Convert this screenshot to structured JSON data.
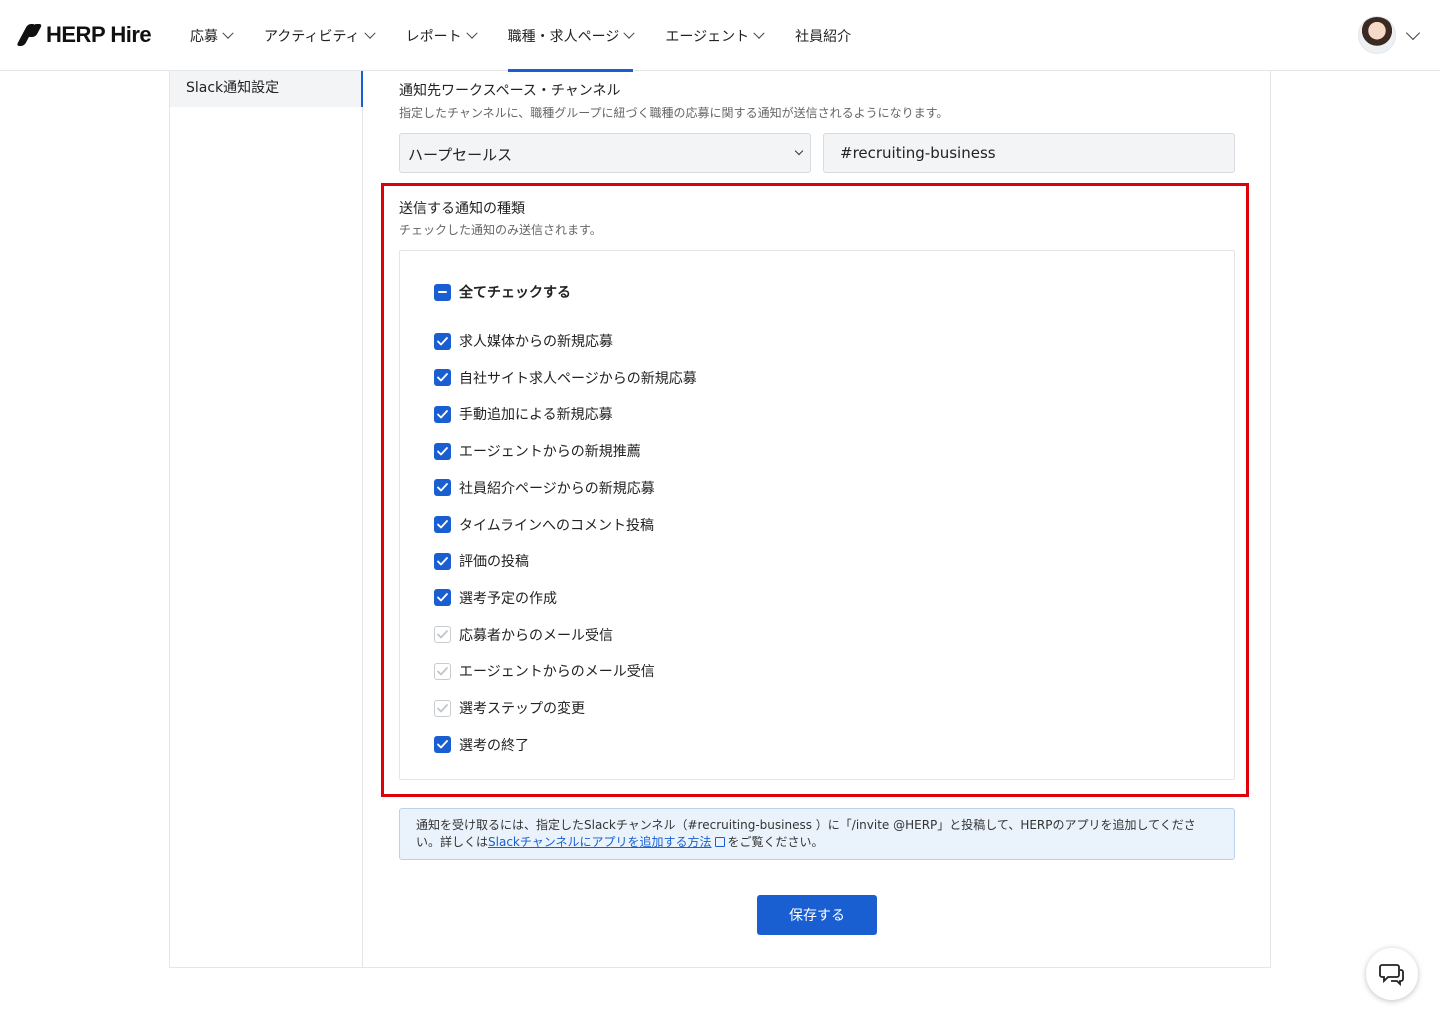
{
  "header": {
    "brand": "HERP Hire",
    "nav": [
      {
        "label": "応募",
        "active": false
      },
      {
        "label": "アクティビティ",
        "active": false
      },
      {
        "label": "レポート",
        "active": false
      },
      {
        "label": "職種・求人ページ",
        "active": true
      },
      {
        "label": "エージェント",
        "active": false
      },
      {
        "label": "社員紹介",
        "active": false
      }
    ]
  },
  "sidebar": {
    "items": [
      {
        "label": "Slack通知設定",
        "active": true
      }
    ]
  },
  "workspace": {
    "title": "通知先ワークスペース・チャンネル",
    "desc": "指定したチャンネルに、職種グループに紐づく職種の応募に関する通知が送信されるようになります。",
    "selected_workspace": "ハープセールス",
    "channel": "#recruiting-business"
  },
  "notifications": {
    "title": "送信する通知の種類",
    "desc": "チェックした通知のみ送信されます。",
    "all_label": "全てチェックする",
    "items": [
      {
        "label": "求人媒体からの新規応募",
        "checked": true
      },
      {
        "label": "自社サイト求人ページからの新規応募",
        "checked": true
      },
      {
        "label": "手動追加による新規応募",
        "checked": true
      },
      {
        "label": "エージェントからの新規推薦",
        "checked": true
      },
      {
        "label": "社員紹介ページからの新規応募",
        "checked": true
      },
      {
        "label": "タイムラインへのコメント投稿",
        "checked": true
      },
      {
        "label": "評価の投稿",
        "checked": true
      },
      {
        "label": "選考予定の作成",
        "checked": true
      },
      {
        "label": "応募者からのメール受信",
        "checked": false
      },
      {
        "label": "エージェントからのメール受信",
        "checked": false
      },
      {
        "label": "選考ステップの変更",
        "checked": false
      },
      {
        "label": "選考の終了",
        "checked": true
      }
    ]
  },
  "notice": {
    "text_before": "通知を受け取るには、指定したSlackチャンネル（#recruiting-business ）に「/invite @HERP」と投稿して、HERPのアプリを追加してください。詳しくは",
    "link": "Slackチャンネルにアプリを追加する方法",
    "text_after": "をご覧ください。"
  },
  "save_label": "保存する",
  "colors": {
    "accent": "#1a5fd1",
    "highlight": "#e0000a",
    "notice_bg": "#eaf3fc"
  },
  "icons": {
    "chat": "chat-bubble-icon",
    "external": "external-link-icon"
  }
}
